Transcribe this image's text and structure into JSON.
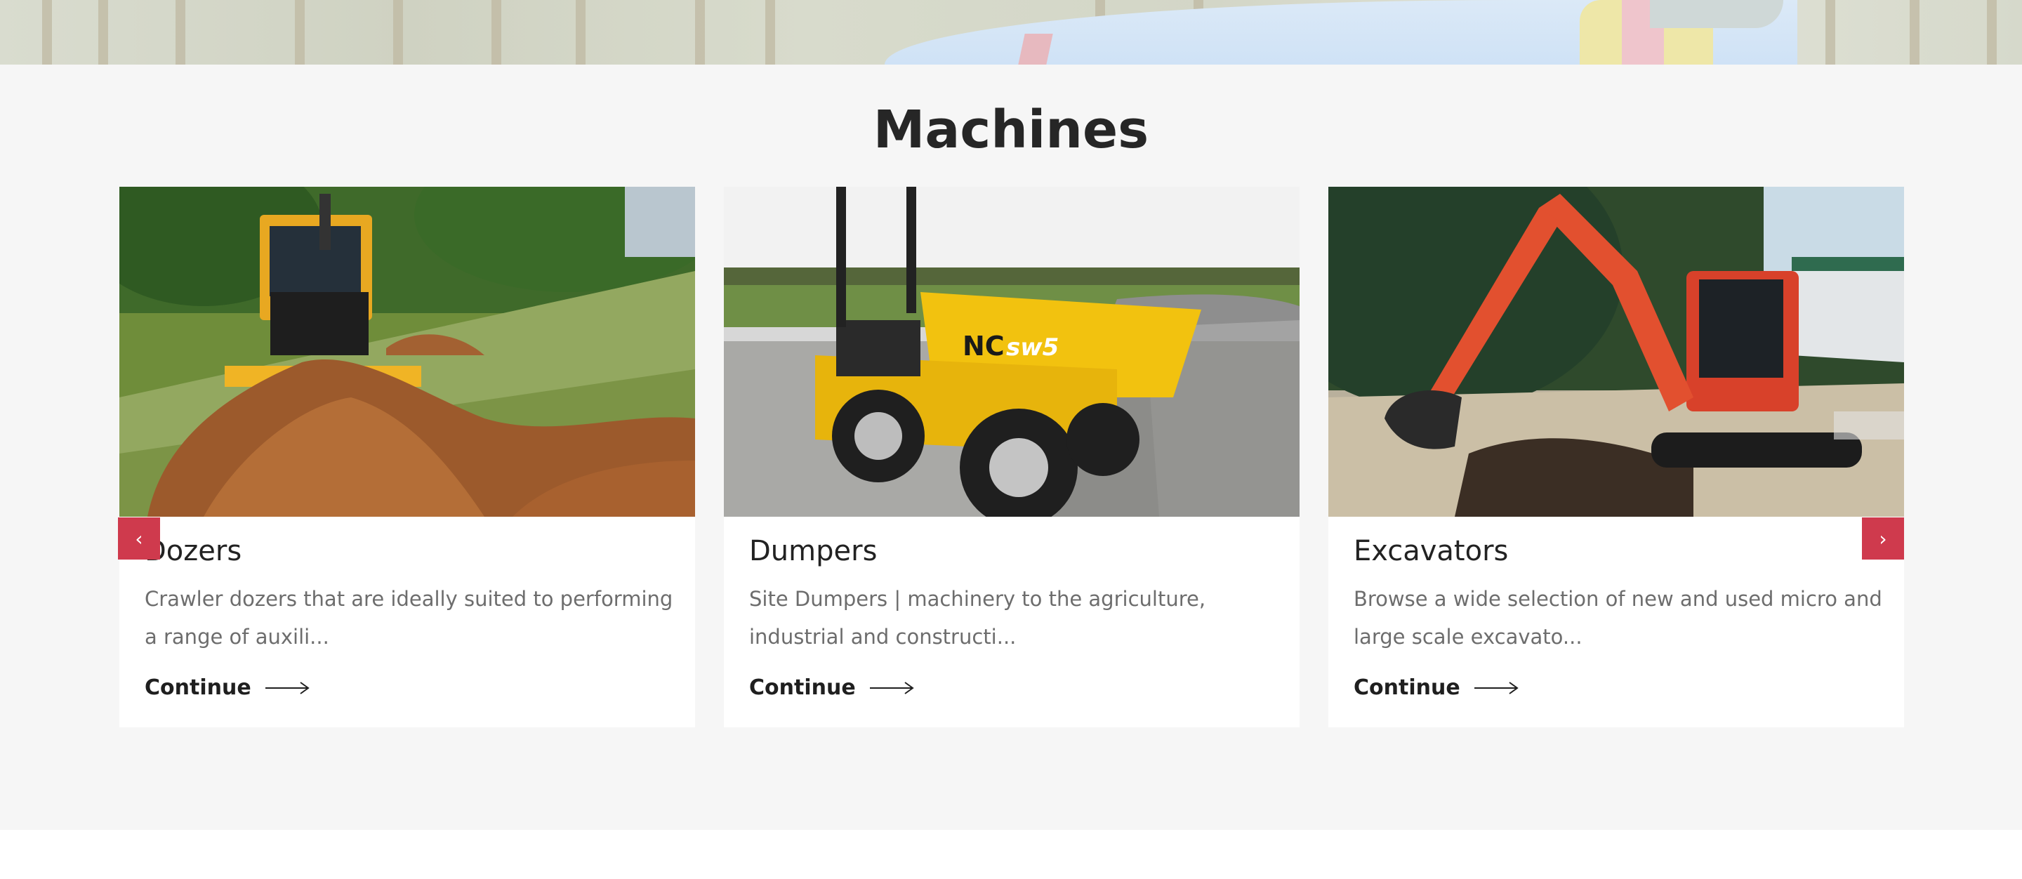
{
  "section": {
    "title": "Machines"
  },
  "colors": {
    "accent": "#cf3a4d",
    "section_bg": "#f6f6f6",
    "heading": "#262626",
    "body_text": "#6d6d6d"
  },
  "carousel": {
    "prev_icon": "chevron-left-icon",
    "next_icon": "chevron-right-icon",
    "prev_glyph": "‹",
    "next_glyph": "›",
    "cards": [
      {
        "title": "Dozers",
        "description": "Crawler dozers that are ideally suited to performing a range of auxili...",
        "link_label": "Continue",
        "image": "yellow crawler dozer pushing soil"
      },
      {
        "title": "Dumpers",
        "description": "Site Dumpers | machinery to the agriculture, industrial and constructi...",
        "link_label": "Continue",
        "image": "yellow site dumper on gravel"
      },
      {
        "title": "Excavators",
        "description": "Browse a wide selection of new and used micro and large scale excavato...",
        "link_label": "Continue",
        "image": "orange mini excavator digging"
      }
    ]
  }
}
